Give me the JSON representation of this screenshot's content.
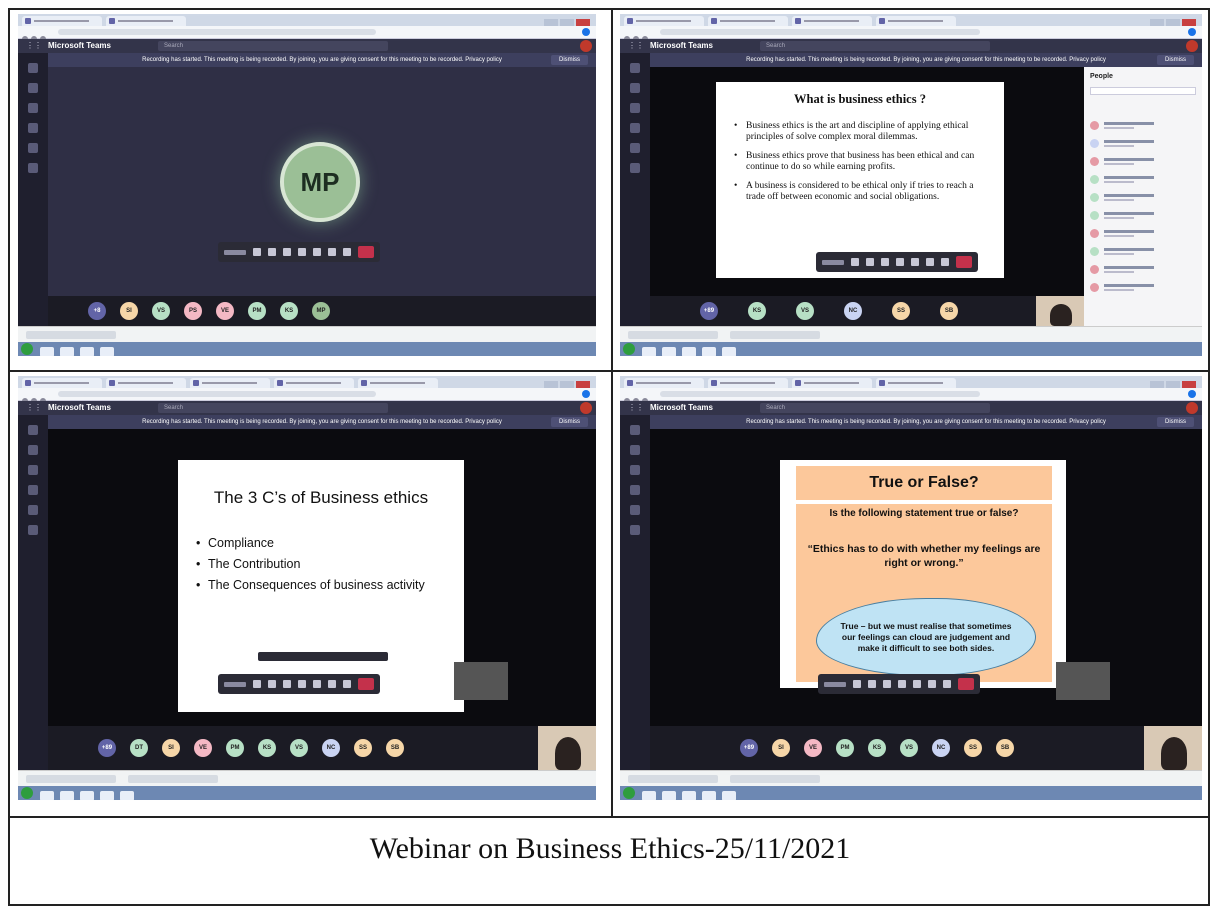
{
  "caption": "Webinar on Business Ethics-25/11/2021",
  "teams": {
    "app_name": "Microsoft Teams",
    "search_placeholder": "Search",
    "recording_banner": "Recording has started. This meeting is being recorded. By joining, you are giving consent for this meeting to be recorded. Privacy policy",
    "dismiss_label": "Dismiss"
  },
  "panel1": {
    "avatar_initials": "MP",
    "participants": [
      {
        "initials": "+8",
        "color": "#6264a7"
      },
      {
        "initials": "SI",
        "color": "#f6d6a8"
      },
      {
        "initials": "VS",
        "color": "#b7e0c5"
      },
      {
        "initials": "PS",
        "color": "#f4b8c4"
      },
      {
        "initials": "VE",
        "color": "#f4b8c4"
      },
      {
        "initials": "PM",
        "color": "#b7e0c5"
      },
      {
        "initials": "KS",
        "color": "#b7e0c5"
      },
      {
        "initials": "MP",
        "color": "#9bbf96"
      }
    ]
  },
  "panel2": {
    "slide_title": "What is business ethics ?",
    "bullets": [
      "Business ethics is the art and discipline of applying ethical principles of solve complex moral dilemmas.",
      "Business ethics prove that business has been ethical and can continue to do so while earning profits.",
      "A business is considered to be ethical only if tries to reach a trade off between economic and social obligations."
    ],
    "people_title": "People",
    "participants": [
      {
        "initials": "+89",
        "color": "#6264a7"
      },
      {
        "initials": "KS",
        "color": "#b7e0c5"
      },
      {
        "initials": "VS",
        "color": "#b7e0c5"
      },
      {
        "initials": "NC",
        "color": "#c9d3f2"
      },
      {
        "initials": "SS",
        "color": "#f6d6a8"
      },
      {
        "initials": "SB",
        "color": "#f6d6a8"
      }
    ]
  },
  "panel3": {
    "slide_title": "The 3 C’s of Business ethics",
    "bullets": [
      "Compliance",
      "The Contribution",
      "The Consequences of business activity"
    ],
    "participants": [
      {
        "initials": "+89",
        "color": "#6264a7"
      },
      {
        "initials": "DT",
        "color": "#b7e0c5"
      },
      {
        "initials": "SI",
        "color": "#f6d6a8"
      },
      {
        "initials": "VE",
        "color": "#f4b8c4"
      },
      {
        "initials": "PM",
        "color": "#b7e0c5"
      },
      {
        "initials": "KS",
        "color": "#b7e0c5"
      },
      {
        "initials": "VS",
        "color": "#b7e0c5"
      },
      {
        "initials": "NC",
        "color": "#c9d3f2"
      },
      {
        "initials": "SS",
        "color": "#f6d6a8"
      },
      {
        "initials": "SB",
        "color": "#f6d6a8"
      }
    ]
  },
  "panel4": {
    "slide_title": "True or False?",
    "question": "Is the following statement true or false?",
    "statement": "“Ethics has to do with whether my feelings are right or wrong.”",
    "answer": "True – but we must realise that sometimes our feelings can cloud are judgement and make it difficult to see both sides.",
    "participants": [
      {
        "initials": "+89",
        "color": "#6264a7"
      },
      {
        "initials": "SI",
        "color": "#f6d6a8"
      },
      {
        "initials": "VE",
        "color": "#f4b8c4"
      },
      {
        "initials": "PM",
        "color": "#b7e0c5"
      },
      {
        "initials": "KS",
        "color": "#b7e0c5"
      },
      {
        "initials": "VS",
        "color": "#b7e0c5"
      },
      {
        "initials": "NC",
        "color": "#c9d3f2"
      },
      {
        "initials": "SS",
        "color": "#f6d6a8"
      },
      {
        "initials": "SB",
        "color": "#f6d6a8"
      }
    ]
  }
}
